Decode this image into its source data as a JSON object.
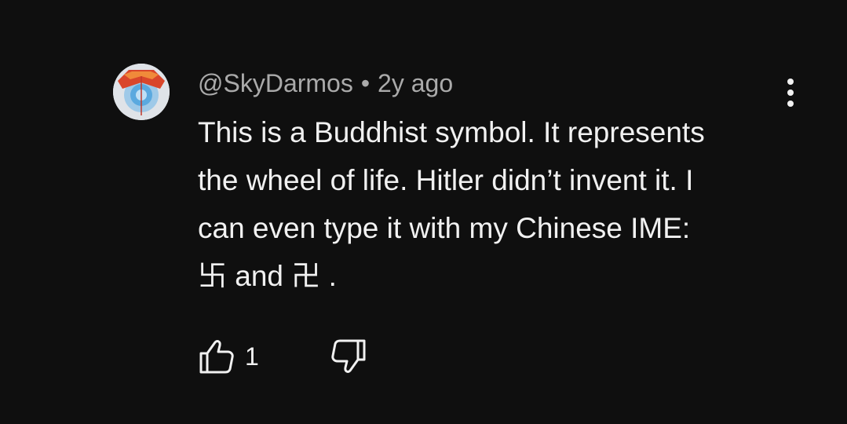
{
  "comment": {
    "author": "@SkyDarmos",
    "separator": "•",
    "time": "2y ago",
    "lines": [
      "This is a Buddhist symbol. It represents",
      "the wheel of life. Hitler didn’t invent it. I",
      "can even type it with my Chinese IME:"
    ],
    "last_line": {
      "symbol_1": "卐",
      "middle": " and ",
      "symbol_2": "卍",
      "end": " ."
    },
    "like_count": "1"
  },
  "icons": {
    "more": "more-vert-icon",
    "like": "thumbs-up-icon",
    "dislike": "thumbs-down-icon"
  },
  "colors": {
    "background": "#0f0f0f",
    "text": "#f1f1f1",
    "meta": "#aaaaaa"
  }
}
